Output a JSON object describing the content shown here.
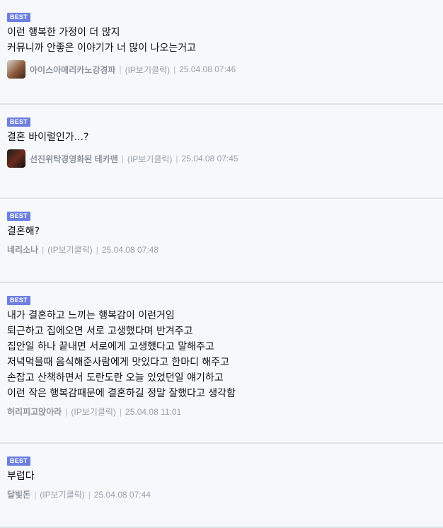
{
  "comments": [
    {
      "badge": "BEST",
      "lines": [
        "이런 행복한 가정이 더 많지",
        "커뮤니까 안좋은 이야기가 너 많이 나오는거고"
      ],
      "has_avatar": true,
      "avatar_icon": "chocolate-drink-avatar-icon",
      "nickname": "아이스아메리카노강경파",
      "ip": "(IP보기클릭)",
      "time": "25.04.08 07:46"
    },
    {
      "badge": "BEST",
      "lines": [
        "결혼 바이럴인가...?"
      ],
      "has_avatar": true,
      "avatar_icon": "dark-figure-avatar-icon",
      "nickname": "선진위탁경영화된 테카맨",
      "ip": "(IP보기클릭)",
      "time": "25.04.08 07:45"
    },
    {
      "badge": "BEST",
      "lines": [
        "결혼해?"
      ],
      "has_avatar": false,
      "nickname": "네리소나",
      "ip": "(IP보기클릭)",
      "time": "25.04.08 07:48"
    },
    {
      "badge": "BEST",
      "lines": [
        "내가 결혼하고 느끼는 행복감이 이런거임",
        "퇴근하고 집에오면 서로 고생했다며 반겨주고",
        "집안일 하나 끝내면 서로에게 고생했다고 말해주고",
        "저녁먹을때 음식해준사람에게 맛있다고 한마디 해주고",
        "손잡고 산책하면서 도란도란 오늘 있었던일 얘기하고",
        "이런 작은 행복감때문에 결혼하길 정말 잘했다고 생각함"
      ],
      "has_avatar": false,
      "nickname": "허리피고앉아라",
      "ip": "(IP보기클릭)",
      "time": "25.04.08 11:01"
    },
    {
      "badge": "BEST",
      "lines": [
        "부럽다"
      ],
      "has_avatar": false,
      "nickname": "달빛돈",
      "ip": "(IP보기클릭)",
      "time": "25.04.08 07:44"
    }
  ],
  "separator": "|",
  "colors": {
    "badge_bg": "#6d7fe0",
    "page_bg": "#f6f8fc",
    "meta_text": "#9aa0a8"
  }
}
